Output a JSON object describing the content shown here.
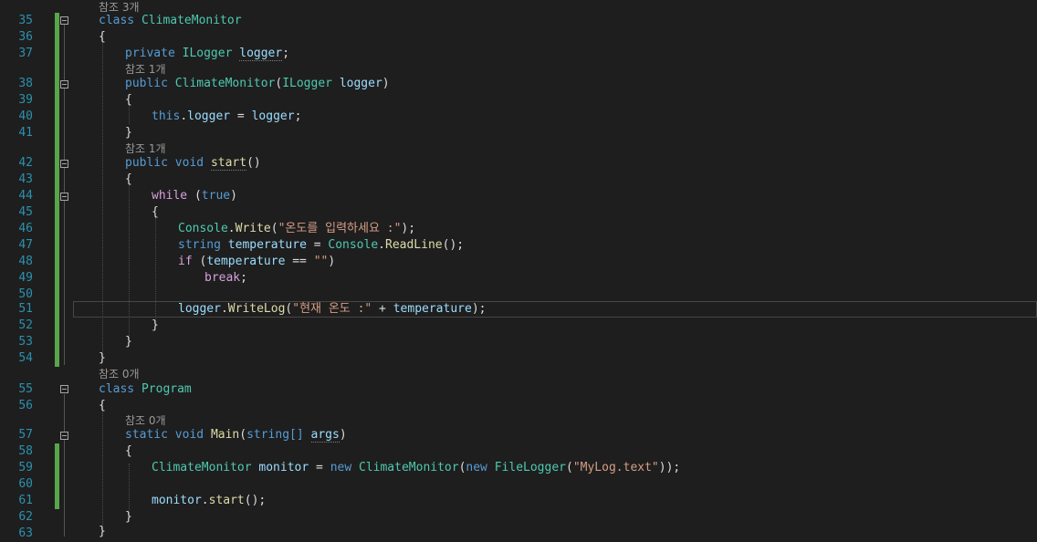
{
  "editor": {
    "lines": [
      {
        "n": "35"
      },
      {
        "n": "36"
      },
      {
        "n": "37"
      },
      {
        "n": "38"
      },
      {
        "n": "39"
      },
      {
        "n": "40"
      },
      {
        "n": "41"
      },
      {
        "n": "42"
      },
      {
        "n": "43"
      },
      {
        "n": "44"
      },
      {
        "n": "45"
      },
      {
        "n": "46"
      },
      {
        "n": "47"
      },
      {
        "n": "48"
      },
      {
        "n": "49"
      },
      {
        "n": "50"
      },
      {
        "n": "51"
      },
      {
        "n": "52"
      },
      {
        "n": "53"
      },
      {
        "n": "54"
      },
      {
        "n": "55"
      },
      {
        "n": "56"
      },
      {
        "n": "57"
      },
      {
        "n": "58"
      },
      {
        "n": "59"
      },
      {
        "n": "60"
      },
      {
        "n": "61"
      },
      {
        "n": "62"
      },
      {
        "n": "63"
      }
    ],
    "codelens": {
      "ref_3": "참조 3개",
      "ref_1a": "참조 1개",
      "ref_1b": "참조 1개",
      "ref_0a": "참조 0개",
      "ref_0b": "참조 0개"
    },
    "tokens": {
      "class_kw": "class",
      "climate_monitor": "ClimateMonitor",
      "open_brace": "{",
      "close_brace": "}",
      "private_kw": "private",
      "ilogger": "ILogger",
      "logger_field": "logger",
      "semicolon": ";",
      "public_kw": "public",
      "ctor_params_open": "(",
      "logger_param": "logger",
      "paren_close": ")",
      "this_kw": "this",
      "dot": ".",
      "assign": " = ",
      "void_kw": "void",
      "start": "start",
      "empty_parens": "()",
      "while_kw": "while",
      "true_kw": "true",
      "console": "Console",
      "write": "Write",
      "write_str": "\"온도를 입력하세요 :\"",
      "close_call": ");",
      "string_kw": "string",
      "temperature": "temperature",
      "readline": "ReadLine",
      "if_kw": "if",
      "eqeq": " == ",
      "empty_str": "\"\"",
      "break_kw": "break",
      "logger_var": "logger",
      "writelog": "WriteLog",
      "log_str": "\"현재 온도 :\"",
      "plus": " + ",
      "program": "Program",
      "static_kw": "static",
      "main": "Main",
      "string_arr": "string[]",
      "args": "args",
      "monitor": "monitor",
      "new_kw": "new",
      "filelogger": "FileLogger",
      "file_str": "\"MyLog.text\"",
      "double_close": "));",
      "monitor_start": "start",
      "call_end": "();"
    }
  }
}
